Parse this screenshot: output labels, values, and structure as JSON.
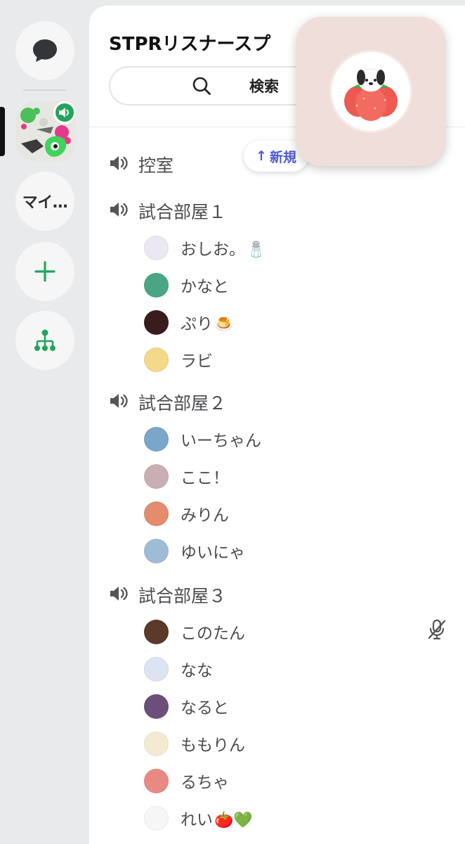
{
  "rail": {
    "my_label": "マイ…"
  },
  "server": {
    "name": "STPRリスナースプ"
  },
  "search": {
    "label": "検索"
  },
  "new_chip": {
    "arrow": "↑",
    "label": "新規"
  },
  "channels": [
    {
      "name": "控室",
      "members": []
    },
    {
      "name": "試合部屋１",
      "members": [
        {
          "name": "おしお。",
          "emoji": "🧂",
          "avatar_color": "#ece8f3"
        },
        {
          "name": "かなと",
          "emoji": "",
          "avatar_color": "#4aa583"
        },
        {
          "name": "ぷり",
          "emoji": "🍮",
          "avatar_color": "#3a1c1c"
        },
        {
          "name": "ラビ",
          "emoji": "",
          "avatar_color": "#f3d98a"
        }
      ]
    },
    {
      "name": "試合部屋２",
      "members": [
        {
          "name": "いーちゃん",
          "emoji": "",
          "avatar_color": "#79a6c9"
        },
        {
          "name": "ここ！",
          "emoji": "",
          "avatar_color": "#c9aeb3"
        },
        {
          "name": "みりん",
          "emoji": "",
          "avatar_color": "#e58b6e"
        },
        {
          "name": "ゆいにゃ",
          "emoji": "",
          "avatar_color": "#9fbcd6"
        }
      ]
    },
    {
      "name": "試合部屋３",
      "members": [
        {
          "name": "このたん",
          "emoji": "",
          "avatar_color": "#5b3a2a",
          "muted": true
        },
        {
          "name": "なな",
          "emoji": "",
          "avatar_color": "#dbe4f0"
        },
        {
          "name": "なると",
          "emoji": "",
          "avatar_color": "#6b4f7a"
        },
        {
          "name": "ももりん",
          "emoji": "",
          "avatar_color": "#f4ead2"
        },
        {
          "name": "るちゃ",
          "emoji": "",
          "avatar_color": "#e88a83"
        },
        {
          "name": "れい",
          "emoji": "🍅💚",
          "avatar_color": "#f6f6f6"
        }
      ]
    }
  ],
  "colors": {
    "accent_green": "#22a559",
    "new_chip_blue": "#4d59d6",
    "overlay_bg": "#f0dedb"
  },
  "icons": {
    "chat": "chat-bubble-icon",
    "add": "plus-icon",
    "explore": "hierarchy-icon",
    "search": "search-icon",
    "speaker": "speaker-icon",
    "mute": "mic-off-icon"
  }
}
